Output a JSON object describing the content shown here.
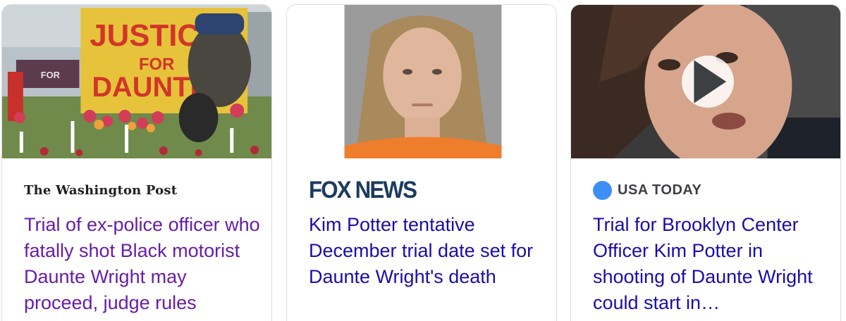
{
  "cards": [
    {
      "source": "The Washington Post",
      "headline": "Trial of ex-police officer who fatally shot Black motorist Daunte Wright may proceed, judge rules",
      "image": {
        "sign_line1": "JUSTICE",
        "sign_line2": "FOR",
        "sign_line3": "DAUNTE",
        "small_sign": "FOR"
      }
    },
    {
      "source": "FOX NEWS",
      "headline": "Kim Potter tentative December trial date set for Daunte Wright's death"
    },
    {
      "source": "USA TODAY",
      "headline": "Trial for Brooklyn Center Officer Kim Potter in shooting of Daunte Wright could start in…",
      "icon": "play-icon"
    }
  ],
  "colors": {
    "visited_link": "#681da8",
    "link": "#1a0dab",
    "usa_today_dot": "#3d8ff5",
    "fox_news": "#1d3a5f"
  }
}
